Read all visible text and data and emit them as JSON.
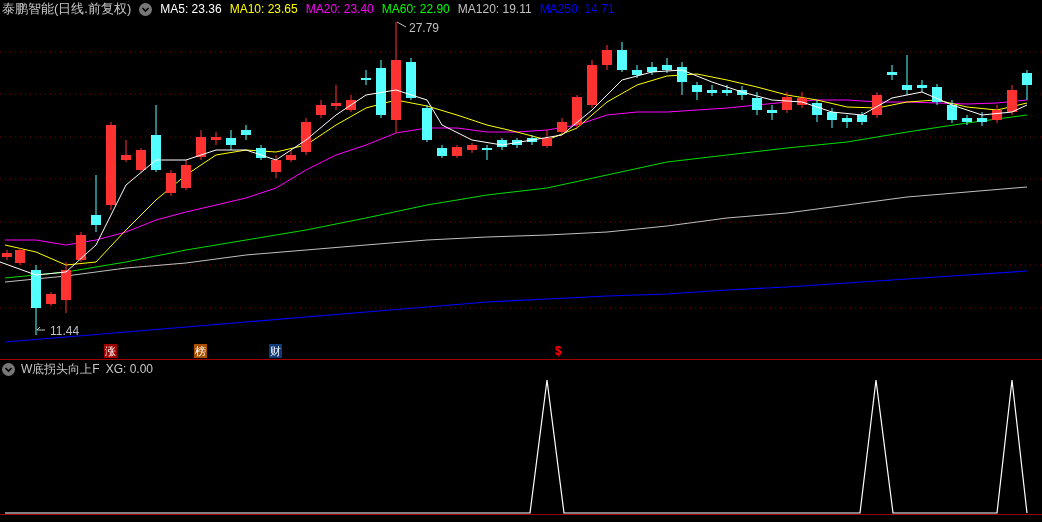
{
  "header": {
    "title": "泰鹏智能(日线.前复权)",
    "indicators": [
      {
        "label": "MA5: 23.36",
        "color": "#ffffff"
      },
      {
        "label": "MA10: 23.65",
        "color": "#ffff00"
      },
      {
        "label": "MA20: 23.40",
        "color": "#ff00ff"
      },
      {
        "label": "MA60: 22.90",
        "color": "#00ff00"
      },
      {
        "label": "MA120: 19.11",
        "color": "#c0c0c0"
      },
      {
        "label": "MA250: 14.71",
        "color": "#0000ff"
      }
    ]
  },
  "price_chart": {
    "high_label": "27.79",
    "low_label": "11.44",
    "event_markers": [
      {
        "kind": "badge",
        "text": "涨",
        "color": "#a00000"
      },
      {
        "kind": "badge",
        "text": "榜",
        "color": "#a85000"
      },
      {
        "kind": "badge",
        "text": "财",
        "color": "#103a78"
      },
      {
        "kind": "glyph",
        "text": "$",
        "color": "#ff0000"
      }
    ]
  },
  "sub_panel": {
    "title": "W底拐头向上F",
    "value": "XG: 0.00"
  }
}
